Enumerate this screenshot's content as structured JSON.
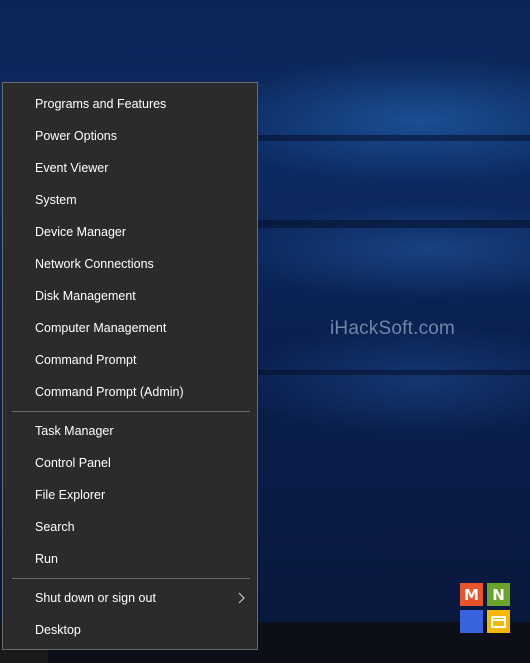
{
  "watermark": "iHackSoft.com",
  "logo": {
    "letters": [
      "M",
      "N"
    ],
    "colors": [
      "#e8542c",
      "#6aa52a",
      "#3a63e0",
      "#f5b800"
    ]
  },
  "menu": {
    "group1": [
      "Programs and Features",
      "Power Options",
      "Event Viewer",
      "System",
      "Device Manager",
      "Network Connections",
      "Disk Management",
      "Computer Management",
      "Command Prompt",
      "Command Prompt (Admin)"
    ],
    "group2": [
      "Task Manager",
      "Control Panel",
      "File Explorer",
      "Search",
      "Run"
    ],
    "group3": [
      "Shut down or sign out",
      "Desktop"
    ],
    "submenu_icon": "chevron-right-icon"
  }
}
